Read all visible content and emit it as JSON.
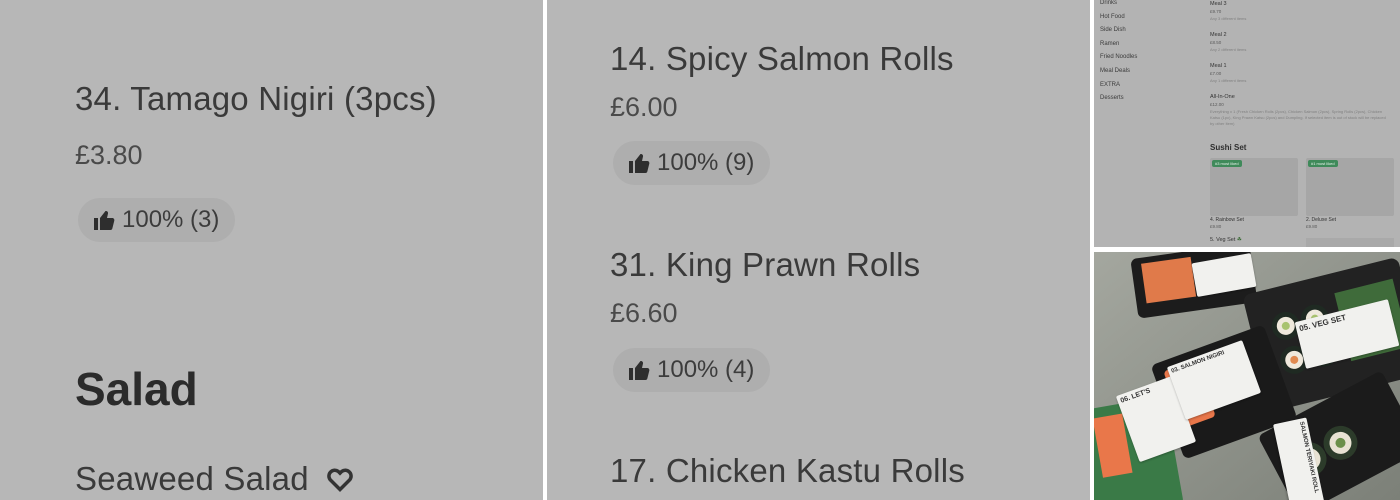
{
  "panel_a": {
    "items": [
      {
        "name": "34. Tamago Nigiri (3pcs)",
        "price": "£3.80",
        "rating": "100% (3)"
      }
    ],
    "section": "Salad",
    "next_item": "Seaweed Salad"
  },
  "panel_b": {
    "items": [
      {
        "name": "14. Spicy Salmon Rolls",
        "price": "£6.00",
        "rating": "100% (9)"
      },
      {
        "name": "31. King Prawn Rolls",
        "price": "£6.60",
        "rating": "100% (4)"
      },
      {
        "name": "17. Chicken Kastu Rolls"
      }
    ]
  },
  "panel_c": {
    "nav": [
      "Drinks",
      "Hot Food",
      "Side Dish",
      "Ramen",
      "Fried Noodles",
      "Meal Deals",
      "EXTRA",
      "Desserts"
    ],
    "meals": [
      {
        "name": "Meal 3",
        "price": "£9.70",
        "desc": "Any 3 different items"
      },
      {
        "name": "Meal 2",
        "price": "£8.50",
        "desc": "Any 2 different items"
      },
      {
        "name": "Meal 1",
        "price": "£7.00",
        "desc": "Any 1 different items"
      },
      {
        "name": "All-In-One",
        "price": "£12.00",
        "desc": "Everything x 1 (Fresh Chicken Rolls (2pcs), Chicken Salmon (2pcs), Spring Rolls (2pcs), Chicken Katsu (1pc), King Prawn Katsu (2pcs) and Dumpling. If selected item is out of stock will be replaced by other item)"
      }
    ],
    "sushi_set_title": "Sushi Set",
    "cards": [
      {
        "badge": "#3 most liked",
        "name": "4. Rainbow Set",
        "price": "£9.80"
      },
      {
        "badge": "#1 most liked",
        "name": "2. Deluxe Set",
        "price": "£9.80"
      }
    ],
    "veg_set": "5. Veg Set"
  },
  "panel_d": {
    "labels": [
      "05. VEG SET",
      "06. LET'S",
      "03. SALMON NIGIRI",
      "SALMON TERIYAKI ROLL"
    ]
  },
  "colors": {
    "badge_green": "#3f8a5a",
    "background_gray": "#b7b7b7"
  }
}
